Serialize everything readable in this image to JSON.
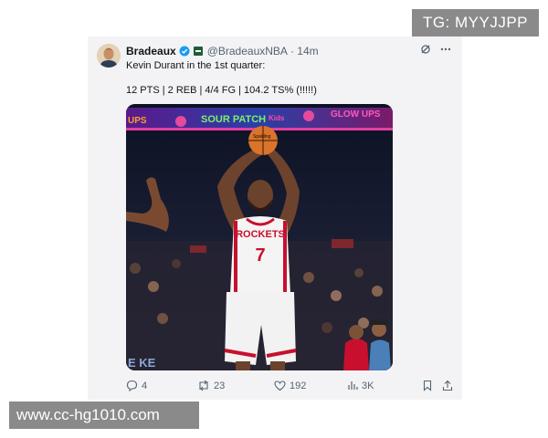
{
  "watermarks": {
    "top": "TG: MYYJJPP",
    "bottom": "www.cc-hg1010.com"
  },
  "tweet": {
    "author_name": "Bradeaux",
    "handle": "@BradeauxNBA",
    "time": "· 14m",
    "line1": "Kevin Durant in the 1st quarter:",
    "line2": "12 PTS | 2 REB | 4/4 FG | 104.2 TS% (!!!!!)",
    "media": {
      "banner_left": "UPS",
      "banner_mid": "SOUR PATCH",
      "banner_mid_small": "Kids",
      "banner_right": "GLOW UPS",
      "jersey_team": "ROCKETS",
      "jersey_number": "7",
      "ball_text": "Spalding",
      "corner_text": "E KE"
    },
    "metrics": {
      "replies": "4",
      "retweets": "23",
      "likes": "192",
      "views": "3K"
    }
  },
  "icons": {
    "verified": "verified-badge-icon",
    "grok": "grok-icon",
    "more": "more-icon",
    "reply": "reply-icon",
    "retweet": "retweet-icon",
    "like": "like-icon",
    "views": "views-icon",
    "bookmark": "bookmark-icon",
    "share": "share-icon"
  },
  "colors": {
    "accent": "#1d9bf0",
    "text": "#0f1419",
    "muted": "#536471",
    "jersey_red": "#c8102e"
  }
}
